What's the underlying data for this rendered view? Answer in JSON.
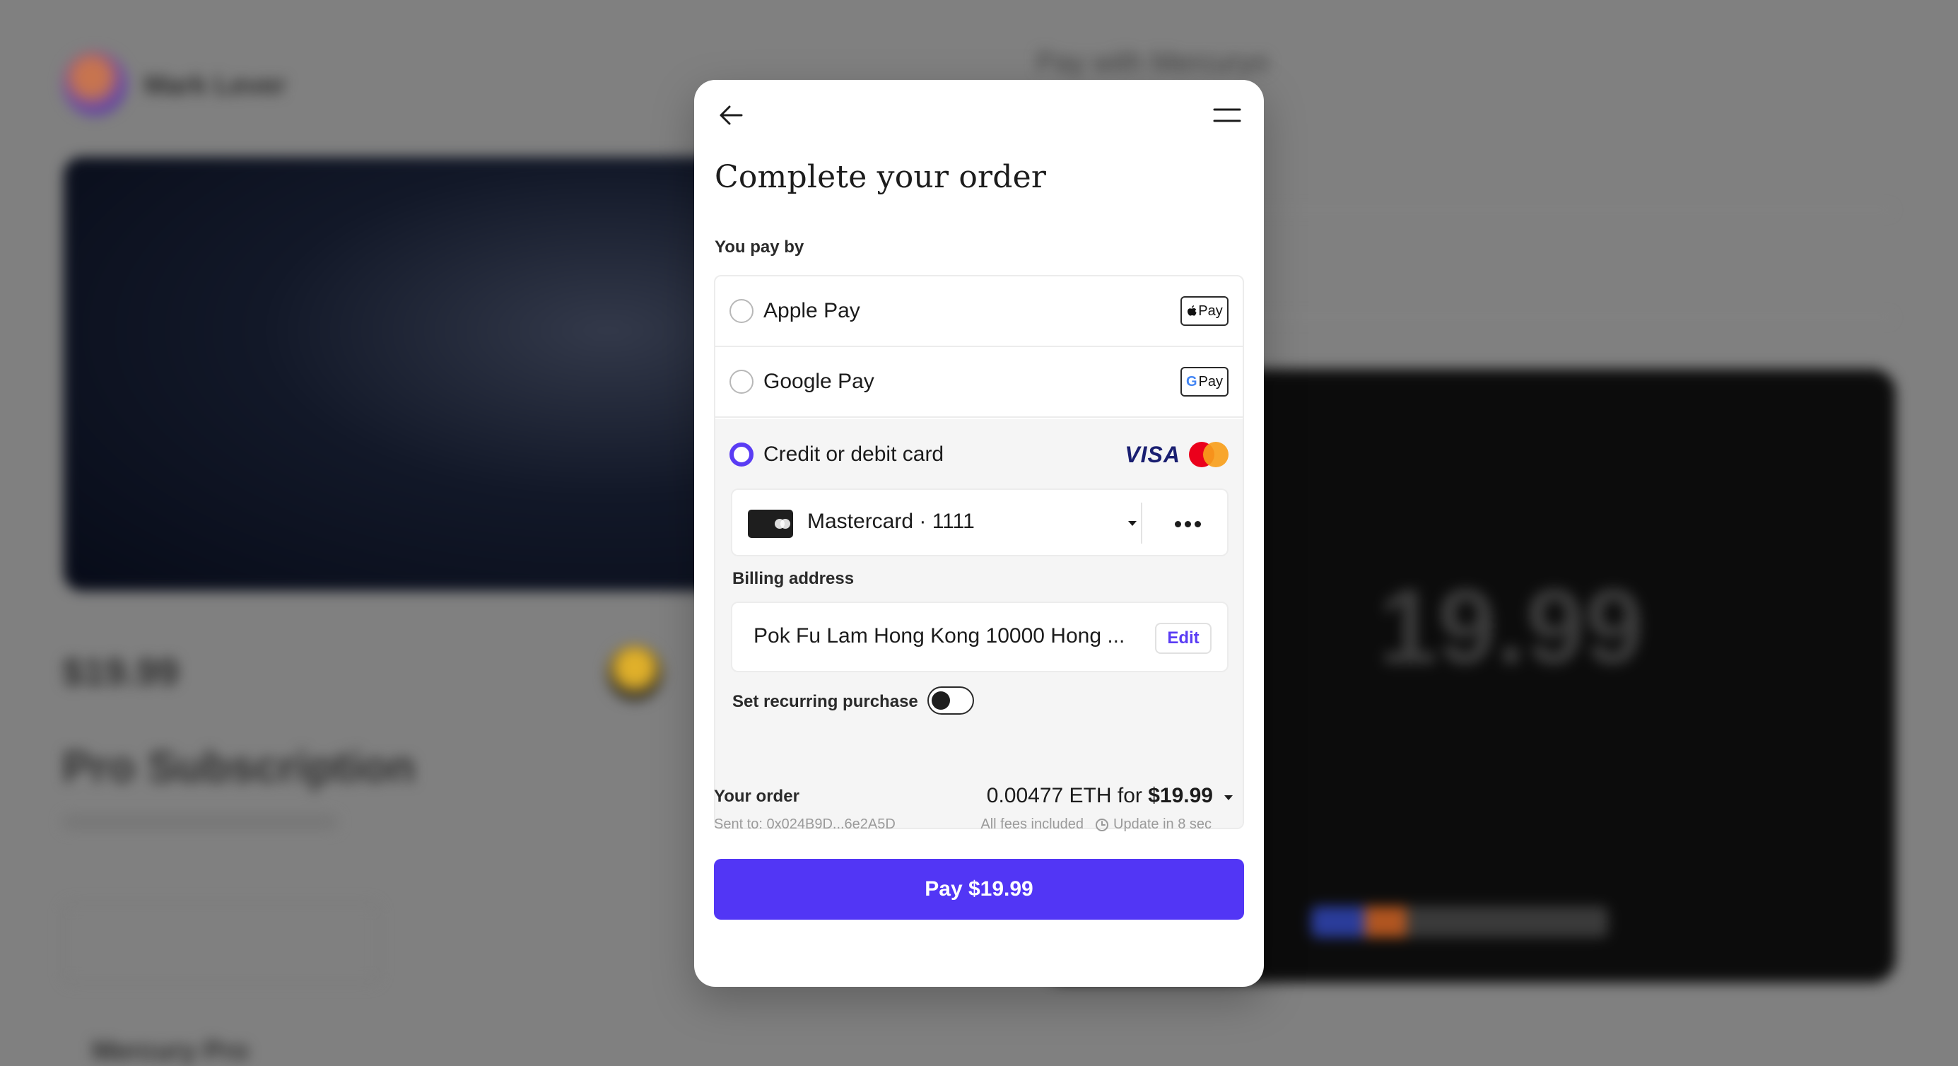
{
  "background": {
    "seller_name": "Mark Lever",
    "price": "$19.99",
    "product_title": "Pro Subscription",
    "right_heading": "Pay with Mercuryo",
    "big_amount": "19.99",
    "footer_text": "Mercury Pro"
  },
  "modal": {
    "title": "Complete your order",
    "pay_by_label": "You pay by",
    "methods": [
      {
        "label": "Apple Pay",
        "badge": "Pay",
        "icon": "apple-icon",
        "selected": false
      },
      {
        "label": "Google Pay",
        "badge": "Pay",
        "badge_prefix": "G",
        "icon": "google-icon",
        "selected": false
      },
      {
        "label": "Credit or debit card",
        "brands": [
          "VISA",
          "Mastercard"
        ],
        "selected": true
      }
    ],
    "card": {
      "name": "Mastercard · 1111"
    },
    "billing": {
      "label": "Billing address",
      "address": "Pok Fu Lam Hong Kong 10000 Hong ...",
      "edit_label": "Edit"
    },
    "recurring": {
      "label": "Set recurring purchase",
      "enabled": false
    },
    "order": {
      "label": "Your order",
      "sent_to": "Sent to: 0x024B9D...6e2A5D",
      "crypto_amount": "0.00477 ETH for",
      "fiat_amount": "$19.99",
      "fees_note": "All fees included",
      "update_note": "Update in 8 sec"
    },
    "pay_button": "Pay $19.99"
  },
  "colors": {
    "accent": "#5236f5",
    "radio_selected": "#5a3cf4",
    "overlay": "#808080"
  }
}
